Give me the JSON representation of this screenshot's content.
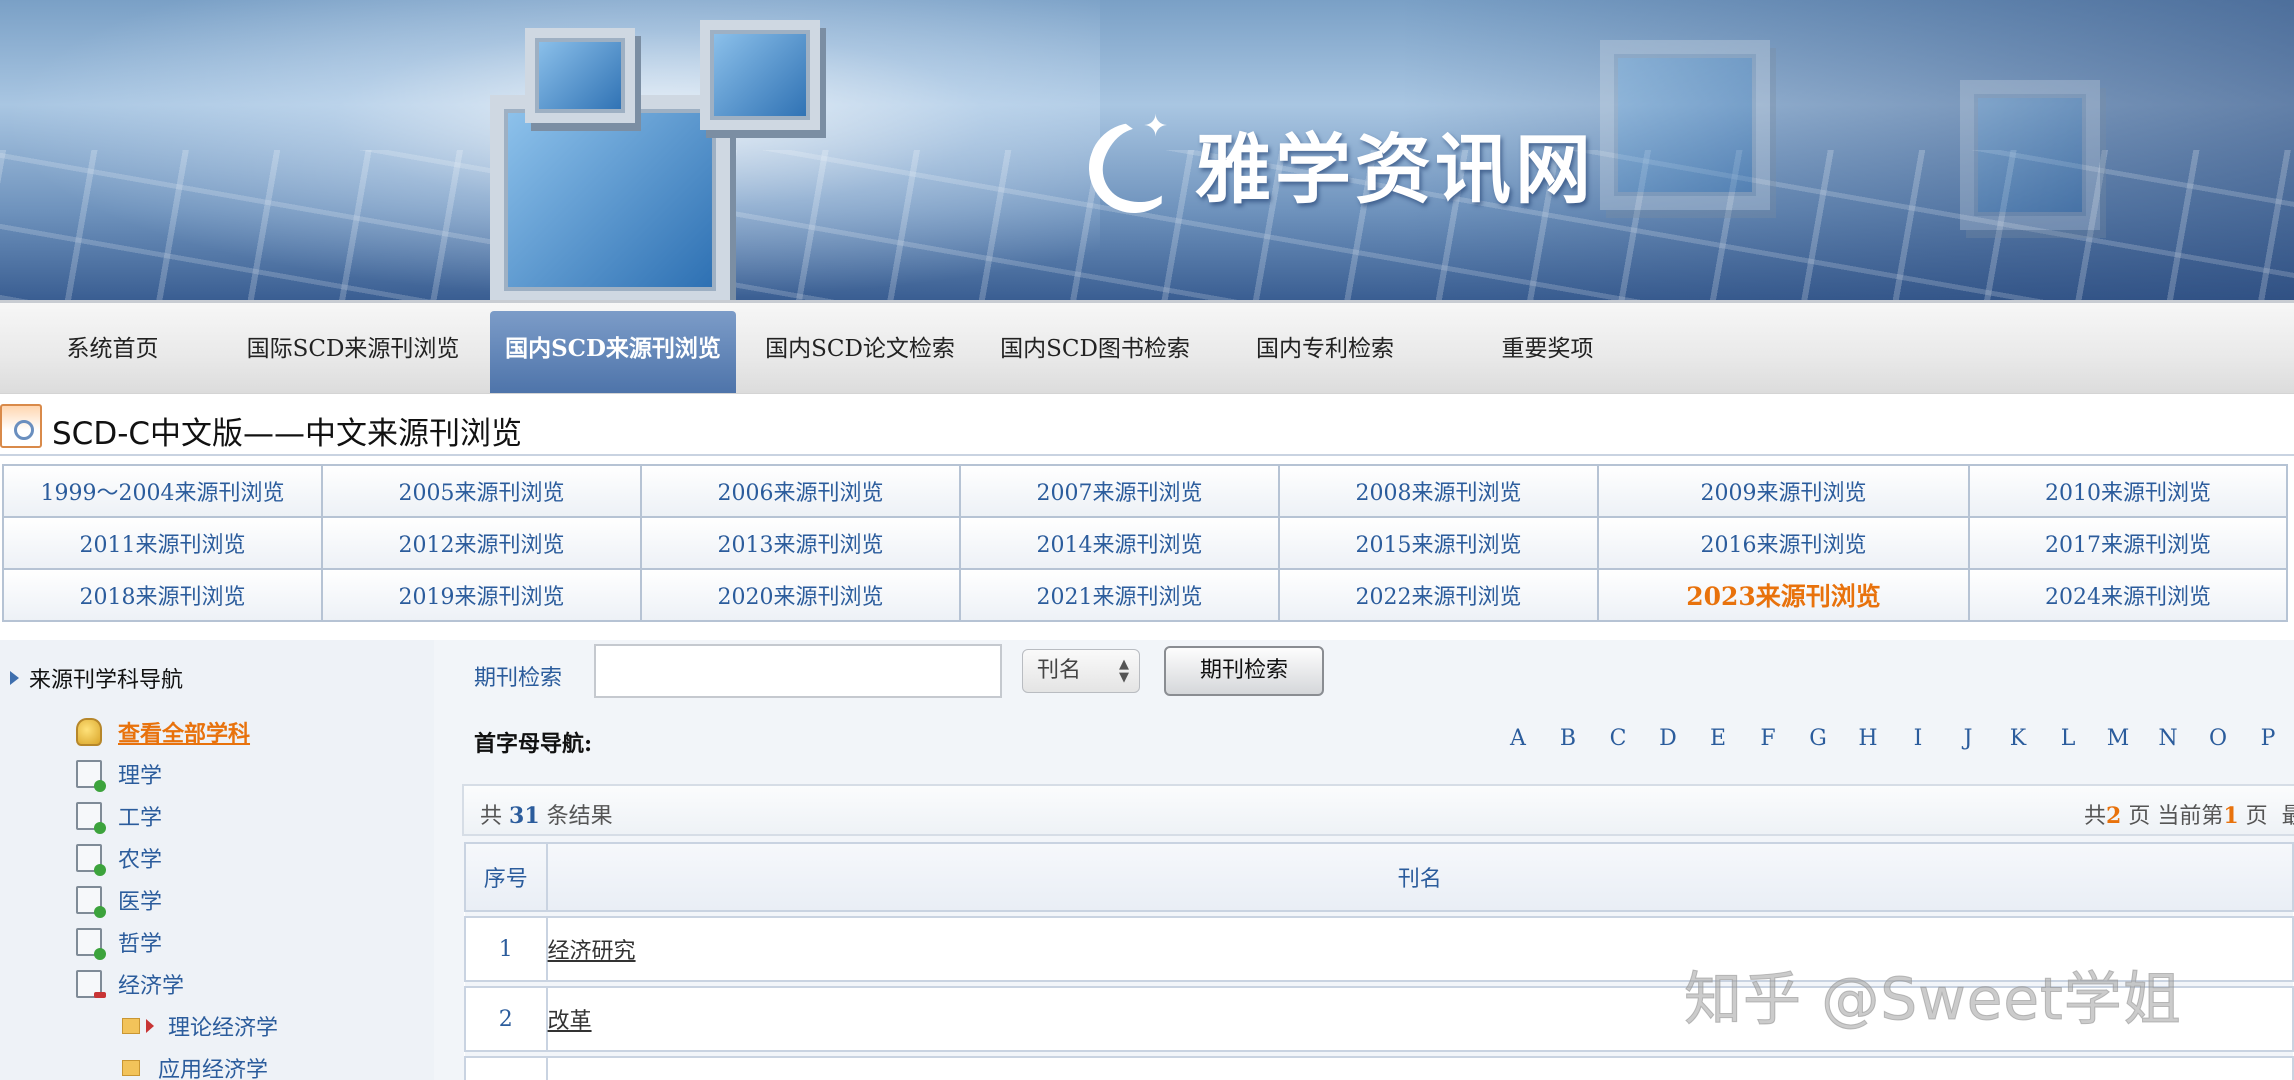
{
  "banner": {
    "logo_text": "雅学资讯网"
  },
  "nav": {
    "items": [
      {
        "label": "系统首页"
      },
      {
        "label": "国际SCD来源刊浏览"
      },
      {
        "label": "国内SCD来源刊浏览"
      },
      {
        "label": "国内SCD论文检索"
      },
      {
        "label": "国内SCD图书检索"
      },
      {
        "label": "国内专利检索"
      },
      {
        "label": "重要奖项"
      }
    ],
    "active_index": 2
  },
  "page_title": "SCD-C中文版——中文来源刊浏览",
  "years": [
    [
      "1999～2004来源刊浏览",
      "2005来源刊浏览",
      "2006来源刊浏览",
      "2007来源刊浏览",
      "2008来源刊浏览",
      "2009来源刊浏览",
      "2010来源刊浏览"
    ],
    [
      "2011来源刊浏览",
      "2012来源刊浏览",
      "2013来源刊浏览",
      "2014来源刊浏览",
      "2015来源刊浏览",
      "2016来源刊浏览",
      "2017来源刊浏览"
    ],
    [
      "2018来源刊浏览",
      "2019来源刊浏览",
      "2020来源刊浏览",
      "2021来源刊浏览",
      "2022来源刊浏览",
      "2023来源刊浏览",
      "2024来源刊浏览"
    ]
  ],
  "highlight_year": "2023来源刊浏览",
  "sidebar": {
    "heading": "来源刊学科导航",
    "view_all": "查看全部学科",
    "subjects": [
      "理学",
      "工学",
      "农学",
      "医学",
      "哲学",
      "经济学"
    ],
    "sub_subjects": [
      "理论经济学",
      "应用经济学"
    ]
  },
  "search": {
    "label": "期刊检索",
    "input_value": "",
    "select_value": "刊名",
    "button_label": "期刊检索"
  },
  "alpha_nav": {
    "label": "首字母导航:",
    "letters": [
      "A",
      "B",
      "C",
      "D",
      "E",
      "F",
      "G",
      "H",
      "I",
      "J",
      "K",
      "L",
      "M",
      "N",
      "O",
      "P"
    ]
  },
  "results": {
    "prefix": "共",
    "count": "31",
    "suffix": "条结果",
    "pages_prefix": "共",
    "pages_total": "2",
    "pages_mid": "页 当前第",
    "current_page": "1",
    "pages_suffix": "页",
    "last_link": "最前"
  },
  "table": {
    "headers": [
      "序号",
      "刊名"
    ],
    "rows": [
      {
        "num": "1",
        "name": "经济研究"
      },
      {
        "num": "2",
        "name": "改革"
      }
    ]
  },
  "watermark": "知乎 @Sweet学姐",
  "colors": {
    "accent": "#2b5c9c",
    "highlight": "#e8720c",
    "nav_active": "#5b7fb5"
  }
}
